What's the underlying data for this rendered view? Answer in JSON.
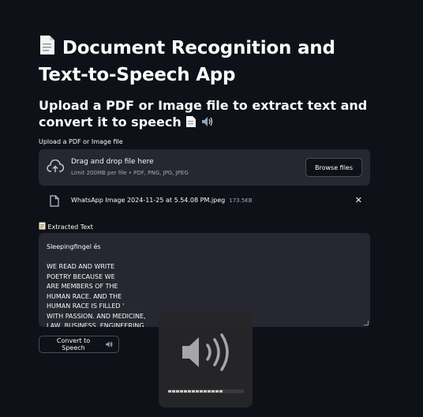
{
  "header": {
    "title": "Document Recognition and Text-to-Speech App",
    "subtitle": "Upload a PDF or Image file to extract text and convert it to speech"
  },
  "uploader": {
    "label": "Upload a PDF or Image file",
    "drop_title": "Drag and drop file here",
    "limit_text": "Limit 200MB per file • PDF, PNG, JPG, JPEG",
    "browse_label": "Browse files"
  },
  "file": {
    "name": "WhatsApp Image 2024-11-25 at 5.54.08 PM.jpeg",
    "size": "173.5KB",
    "close_glyph": "✕"
  },
  "extracted": {
    "label": "Extracted Text",
    "text": "Sleepingfingel és\n\nWE READ AND WRITE\nPOETRY BECAUSE WE\nARE MEMBERS OF THE\nHUMAN RACE. AND THE\nHUMAN RACE IS FILLED '\nWITH PASSION. AND MEDICINE,\nLAW, BUSINESS, ENGINEERING"
  },
  "actions": {
    "convert_label": "Convert to Speech"
  },
  "volume": {
    "level": 0.78
  },
  "colors": {
    "background": "#0e1117",
    "surface": "#262730",
    "text": "#fafafa",
    "muted": "#a3a8b8"
  },
  "icons": [
    "document-emoji-icon",
    "speaker-emoji-icon",
    "upload-cloud-icon",
    "file-icon",
    "close-icon",
    "volume-icon"
  ]
}
